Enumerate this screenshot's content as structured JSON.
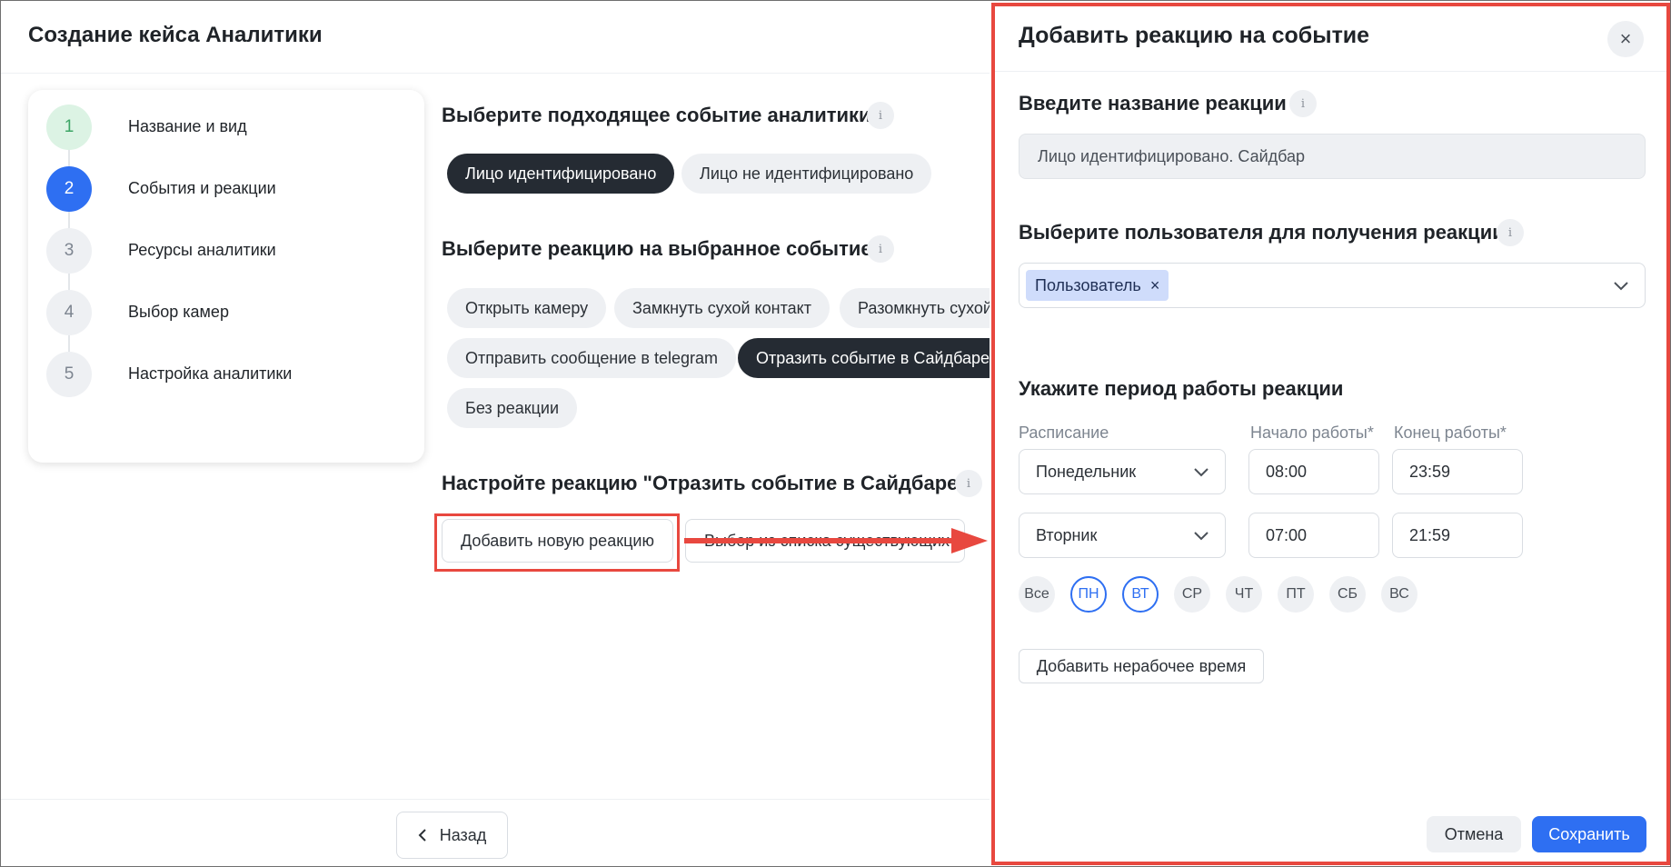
{
  "page": {
    "title": "Создание кейса Аналитики",
    "back_label": "Назад"
  },
  "stepper": {
    "steps": [
      {
        "number": "1",
        "label": "Название и вид",
        "state": "done"
      },
      {
        "number": "2",
        "label": "События и реакции",
        "state": "active"
      },
      {
        "number": "3",
        "label": "Ресурсы аналитики",
        "state": "pending"
      },
      {
        "number": "4",
        "label": "Выбор камер",
        "state": "pending"
      },
      {
        "number": "5",
        "label": "Настройка аналитики",
        "state": "pending"
      }
    ]
  },
  "events": {
    "title": "Выберите подходящее событие аналитики",
    "info": "i",
    "options": [
      "Лицо идентифицировано",
      "Лицо не идентифицировано"
    ],
    "selected": "Лицо идентифицировано"
  },
  "reactions": {
    "title": "Выберите реакцию на выбранное событие",
    "info": "i",
    "options": [
      "Открыть камеру",
      "Замкнуть сухой контакт",
      "Разомкнуть сухой контакт",
      "Отправить сообщение в telegram",
      "Отразить событие в Сайдбаре",
      "Без реакции"
    ],
    "selected": "Отразить событие в Сайдбаре"
  },
  "configure": {
    "title": "Настройте реакцию \"Отразить событие в Сайдбаре\"",
    "info": "i",
    "add_new_label": "Добавить новую реакцию",
    "choose_existing_label": "Выбор из списка существующих"
  },
  "drawer": {
    "title": "Добавить реакцию на событие",
    "close_icon": "×",
    "name_title": "Введите название реакции",
    "name_value": "Лицо идентифицировано. Сайдбар",
    "user_title": "Выберите пользователя для получения реакции",
    "user_tag": "Пользователь",
    "user_tag_remove": "×",
    "period_title": "Укажите период работы реакции",
    "schedule_label": "Расписание",
    "start_label": "Начало работы*",
    "end_label": "Конец работы*",
    "rows": [
      {
        "day": "Понедельник",
        "start": "08:00",
        "end": "23:59"
      },
      {
        "day": "Вторник",
        "start": "07:00",
        "end": "21:59"
      }
    ],
    "days": [
      {
        "label": "Все",
        "selected": false
      },
      {
        "label": "ПН",
        "selected": true
      },
      {
        "label": "ВТ",
        "selected": true
      },
      {
        "label": "СР",
        "selected": false
      },
      {
        "label": "ЧТ",
        "selected": false
      },
      {
        "label": "ПТ",
        "selected": false
      },
      {
        "label": "СБ",
        "selected": false
      },
      {
        "label": "ВС",
        "selected": false
      }
    ],
    "add_nonworking_label": "Добавить нерабочее время",
    "cancel_label": "Отмена",
    "save_label": "Сохранить"
  },
  "colors": {
    "accent": "#2e6ff2",
    "highlight": "#e8483f",
    "chip_dark": "#252b33",
    "chip_light": "#eef0f3"
  }
}
